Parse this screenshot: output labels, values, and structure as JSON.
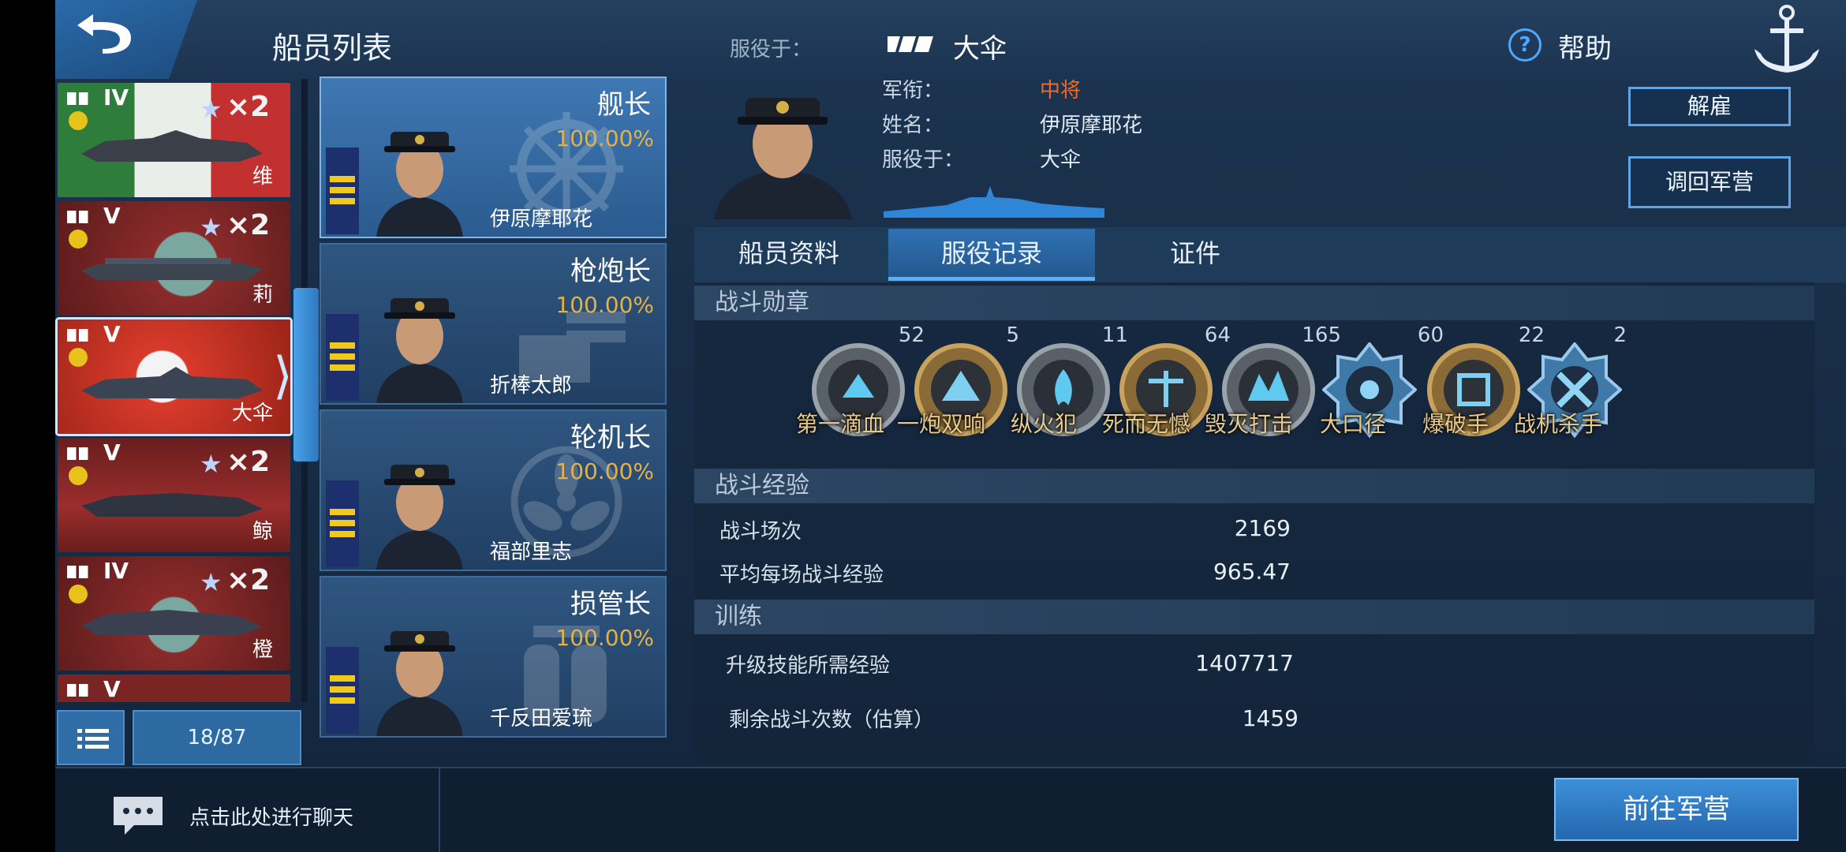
{
  "header": {
    "title": "船员列表",
    "served_label": "服役于：",
    "served_ship": "大伞",
    "help_label": "帮助"
  },
  "ships": [
    {
      "tier": "IV",
      "multiplier": "×2",
      "name": "维",
      "flag": "italy"
    },
    {
      "tier": "V",
      "multiplier": "×2",
      "name": "莉",
      "flag": "red"
    },
    {
      "tier": "V",
      "multiplier": "",
      "name": "大伞",
      "flag": "rising-sun",
      "selected": true
    },
    {
      "tier": "V",
      "multiplier": "×2",
      "name": "鲸",
      "flag": "red"
    },
    {
      "tier": "IV",
      "multiplier": "×2",
      "name": "橙",
      "flag": "red"
    },
    {
      "tier": "V",
      "multiplier": "",
      "name": "",
      "flag": "red"
    }
  ],
  "list_footer": {
    "count": "18/87"
  },
  "crew": [
    {
      "role": "舰长",
      "percent": "100.00%",
      "name": "伊原摩耶花",
      "selected": true
    },
    {
      "role": "枪炮长",
      "percent": "100.00%",
      "name": "折棒太郎"
    },
    {
      "role": "轮机长",
      "percent": "100.00%",
      "name": "福部里志"
    },
    {
      "role": "损管长",
      "percent": "100.00%",
      "name": "千反田爱琉"
    }
  ],
  "detail": {
    "rank_label": "军衔：",
    "rank_value": "中将",
    "name_label": "姓名：",
    "name_value": "伊原摩耶花",
    "served_label": "服役于：",
    "served_value": "大伞",
    "dismiss_label": "解雇",
    "recall_label": "调回军营"
  },
  "tabs": [
    "船员资料",
    "服役记录",
    "证件"
  ],
  "active_tab": "服役记录",
  "medals_section": {
    "title": "战斗勋章",
    "medals": [
      {
        "count": "52",
        "name": "第一滴血",
        "icon": "first-blood-medal-icon"
      },
      {
        "count": "5",
        "name": "一炮双响",
        "icon": "double-strike-medal-icon"
      },
      {
        "count": "11",
        "name": "纵火犯",
        "icon": "arsonist-medal-icon"
      },
      {
        "count": "64",
        "name": "死而无憾",
        "icon": "no-regret-medal-icon"
      },
      {
        "count": "165",
        "name": "毁灭打击",
        "icon": "devastating-strike-medal-icon"
      },
      {
        "count": "60",
        "name": "大口径",
        "icon": "high-caliber-medal-icon"
      },
      {
        "count": "22",
        "name": "爆破手",
        "icon": "demolition-medal-icon"
      },
      {
        "count": "2",
        "name": "战机杀手",
        "icon": "plane-killer-medal-icon"
      }
    ]
  },
  "experience_section": {
    "title": "战斗经验",
    "battles_label": "战斗场次",
    "battles_value": "2169",
    "avg_label": "平均每场战斗经验",
    "avg_value": "965.47"
  },
  "training_section": {
    "title": "训练",
    "xp_needed_label": "升级技能所需经验",
    "xp_needed_value": "1407717",
    "battles_left_label": "剩余战斗次数（估算）",
    "battles_left_value": "1459"
  },
  "bottom": {
    "chat_label": "点击此处进行聊天",
    "go_barracks_label": "前往军营"
  }
}
